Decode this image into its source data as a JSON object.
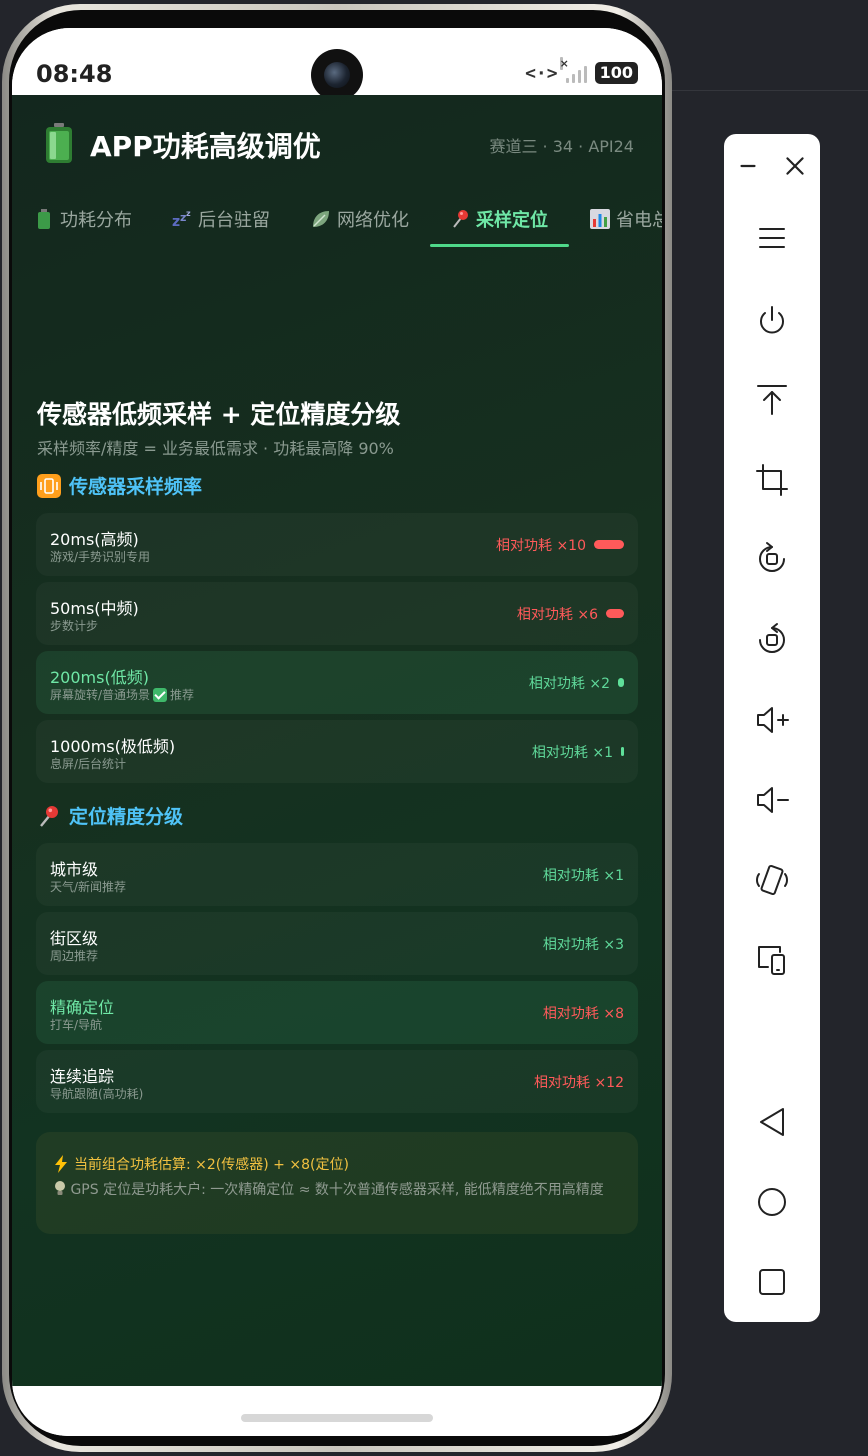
{
  "status_bar": {
    "time": "08:48",
    "battery": "100"
  },
  "app": {
    "title": "APP功耗高级调优",
    "subtitle": "赛道三 · 34 · API24"
  },
  "tabs": [
    {
      "label": "功耗分布",
      "active": false,
      "icon": "battery-icon"
    },
    {
      "label": "后台驻留",
      "active": false,
      "icon": "sleep-icon"
    },
    {
      "label": "网络优化",
      "active": false,
      "icon": "leaf-icon"
    },
    {
      "label": "采样定位",
      "active": true,
      "icon": "pin-icon"
    },
    {
      "label": "省电总",
      "active": false,
      "icon": "chart-icon"
    }
  ],
  "main": {
    "heading": "传感器低频采样 + 定位精度分级",
    "subheading": "采样频率/精度 = 业务最低需求 · 功耗最高降 90%",
    "sensor_section": {
      "title": "传感器采样频率",
      "items": [
        {
          "title": "20ms(高频)",
          "desc": "游戏/手势识别专用",
          "cost": "相对功耗 ×10",
          "level": 10,
          "tone": "red",
          "highlight": false,
          "recommended": false
        },
        {
          "title": "50ms(中频)",
          "desc": "步数计步",
          "cost": "相对功耗 ×6",
          "level": 6,
          "tone": "red",
          "highlight": false,
          "recommended": false
        },
        {
          "title": "200ms(低频)",
          "desc": "屏幕旋转/普通场景",
          "tag": "推荐",
          "cost": "相对功耗 ×2",
          "level": 2,
          "tone": "green",
          "highlight": true,
          "recommended": true
        },
        {
          "title": "1000ms(极低频)",
          "desc": "息屏/后台统计",
          "cost": "相对功耗 ×1",
          "level": 1,
          "tone": "green",
          "highlight": false,
          "recommended": false
        }
      ]
    },
    "location_section": {
      "title": "定位精度分级",
      "items": [
        {
          "title": "城市级",
          "desc": "天气/新闻推荐",
          "cost": "相对功耗 ×1",
          "tone": "green",
          "highlight": false
        },
        {
          "title": "街区级",
          "desc": "周边推荐",
          "cost": "相对功耗 ×3",
          "tone": "green",
          "highlight": false
        },
        {
          "title": "精确定位",
          "desc": "打车/导航",
          "cost": "相对功耗 ×8",
          "tone": "red",
          "highlight": true
        },
        {
          "title": "连续追踪",
          "desc": "导航跟随(高功耗)",
          "cost": "相对功耗 ×12",
          "tone": "red",
          "highlight": false
        }
      ]
    },
    "note": {
      "line1": "当前组合功耗估算: ×2(传感器) + ×8(定位)",
      "line2": "GPS 定位是功耗大户: 一次精确定位 ≈ 数十次普通传感器采样, 能低精度绝不用高精度"
    }
  },
  "colors": {
    "accent": "#6fe7a6",
    "danger": "#ff5a5a",
    "section": "#4fc3f7",
    "warning": "#f0c040"
  }
}
